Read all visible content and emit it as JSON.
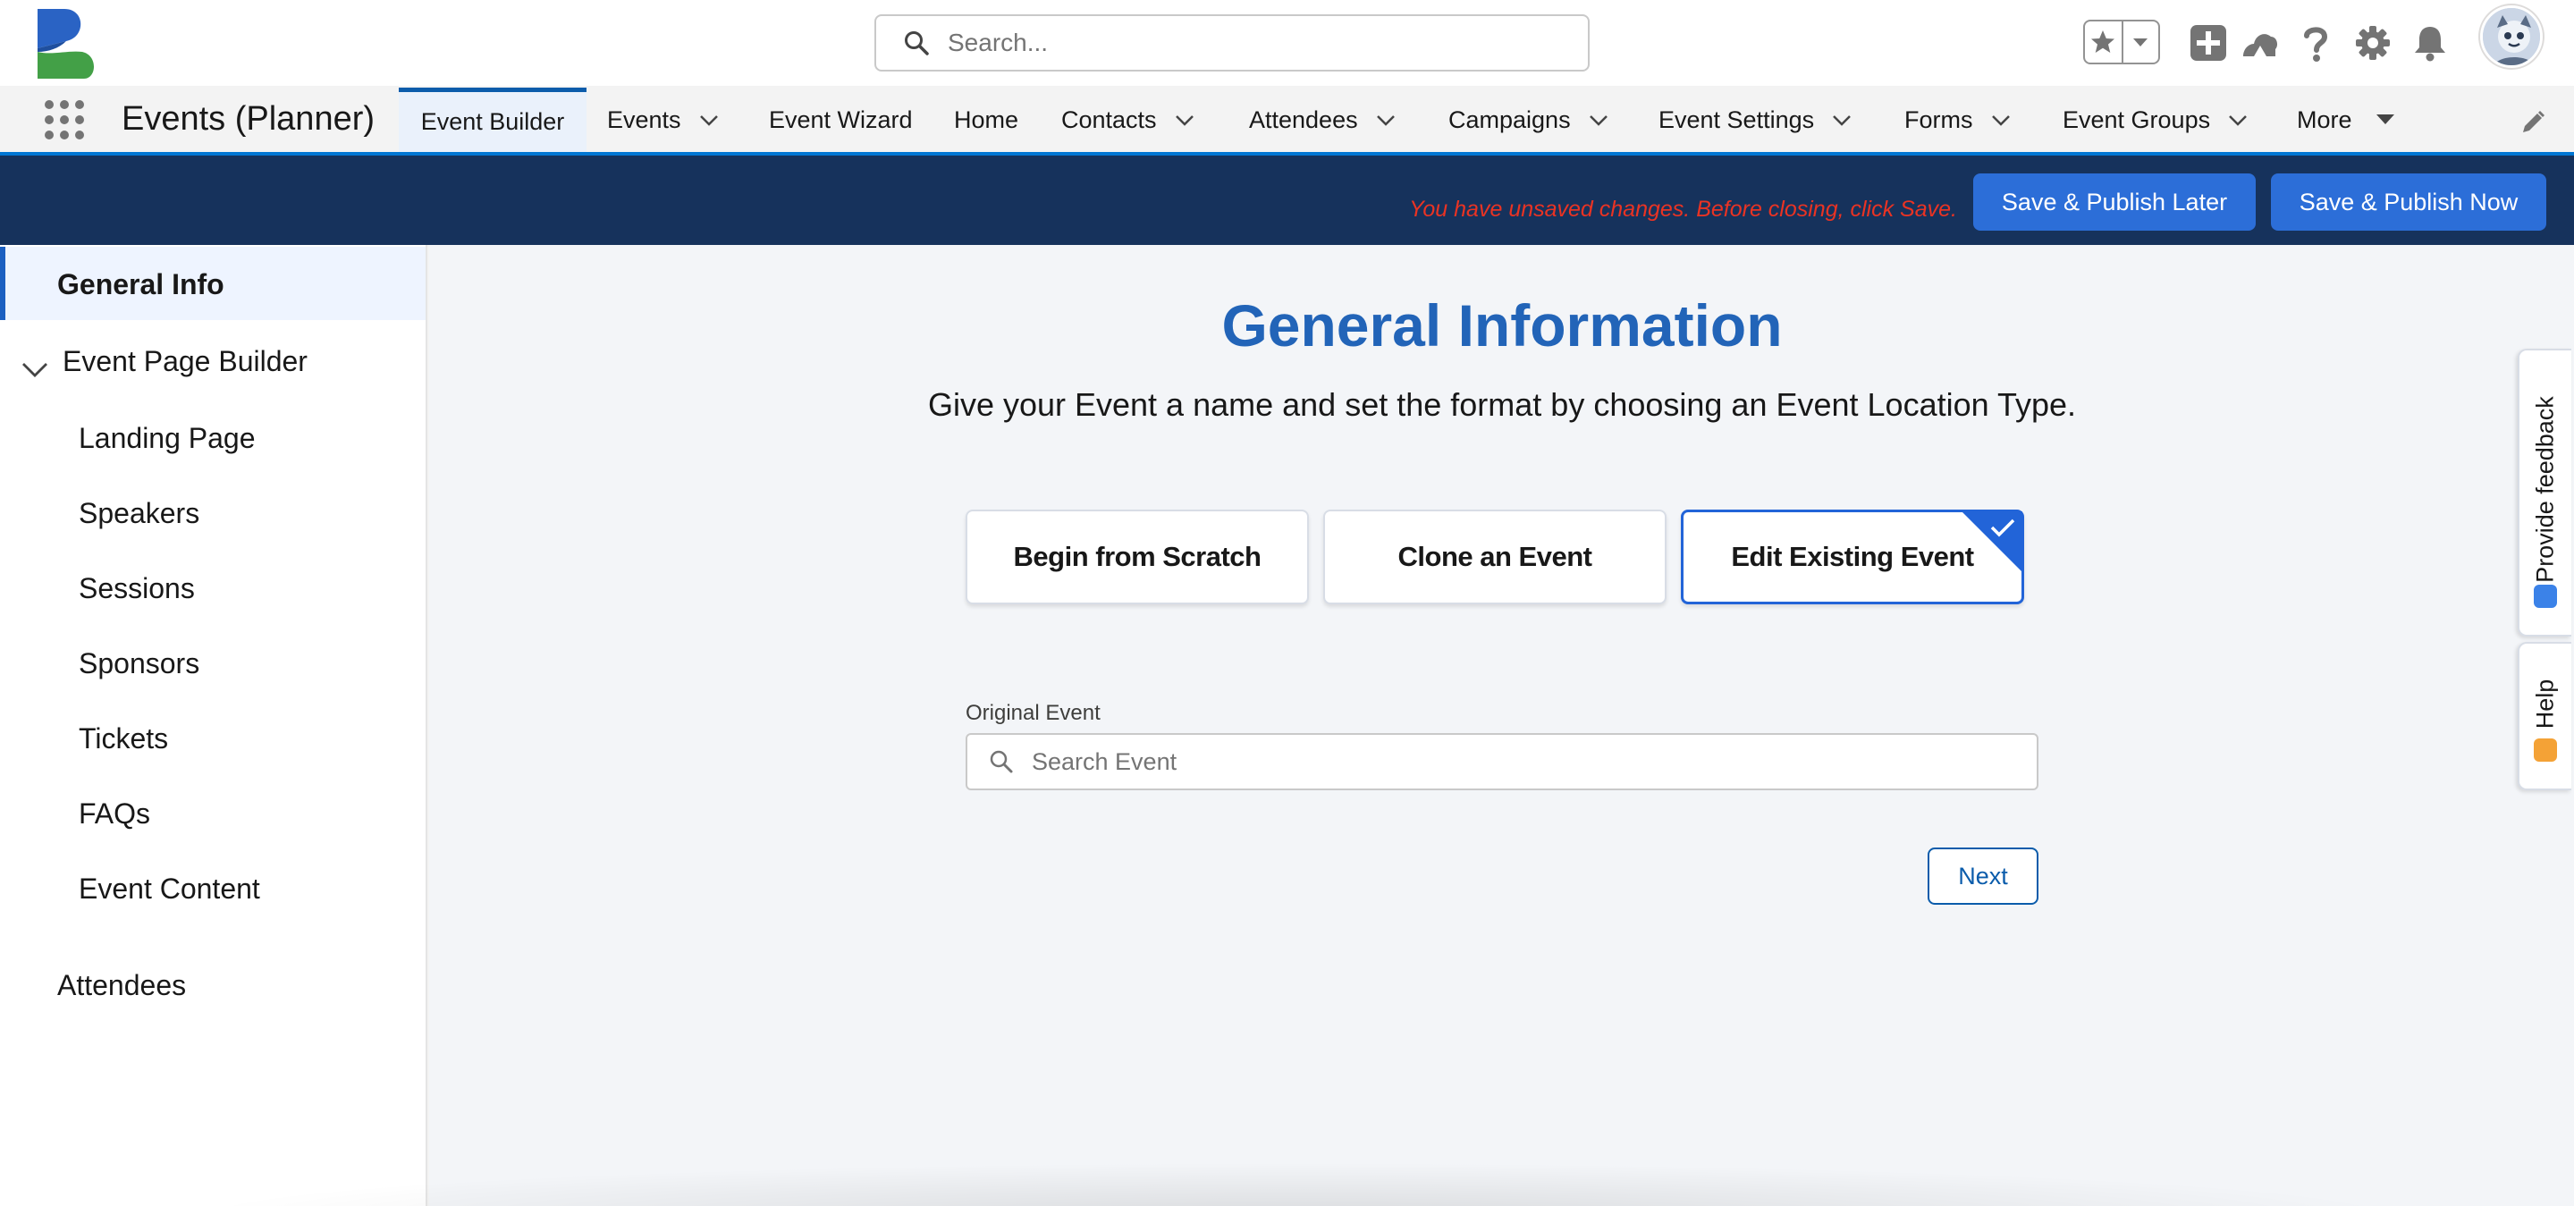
{
  "header": {
    "search_placeholder": "Search...",
    "icons": [
      "favorites-star-icon",
      "favorites-dropdown-icon",
      "add-icon",
      "trailhead-icon",
      "help-icon",
      "setup-gear-icon",
      "notification-bell-icon",
      "user-avatar"
    ]
  },
  "nav": {
    "app_name": "Events (Planner)",
    "tabs": [
      {
        "label": "Event Builder",
        "active": true,
        "dropdown": false
      },
      {
        "label": "Events",
        "dropdown": true
      },
      {
        "label": "Event Wizard",
        "dropdown": false
      },
      {
        "label": "Home",
        "dropdown": false
      },
      {
        "label": "Contacts",
        "dropdown": true
      },
      {
        "label": "Attendees",
        "dropdown": true
      },
      {
        "label": "Campaigns",
        "dropdown": true
      },
      {
        "label": "Event Settings",
        "dropdown": true
      },
      {
        "label": "Forms",
        "dropdown": true
      },
      {
        "label": "Event Groups",
        "dropdown": true
      },
      {
        "label": "More",
        "dropdown": true
      }
    ]
  },
  "action_bar": {
    "unsaved_message": "You have unsaved changes. Before closing, click Save.",
    "save_later_label": "Save & Publish Later",
    "save_now_label": "Save & Publish Now"
  },
  "sidebar": {
    "active_item": "General Info",
    "section": "Event Page Builder",
    "sub_items": [
      "Landing Page",
      "Speakers",
      "Sessions",
      "Sponsors",
      "Tickets",
      "FAQs",
      "Event Content"
    ],
    "bottom_item": "Attendees"
  },
  "main": {
    "title": "General Information",
    "subtitle": "Give your Event a name and set the format by choosing an Event Location Type.",
    "choices": [
      {
        "label": "Begin from Scratch",
        "selected": false
      },
      {
        "label": "Clone an Event",
        "selected": false
      },
      {
        "label": "Edit Existing Event",
        "selected": true
      }
    ],
    "original_event_label": "Original Event",
    "original_event_placeholder": "Search Event",
    "next_label": "Next"
  },
  "dock": {
    "feedback_label": "Provide feedback",
    "help_label": "Help"
  },
  "colors": {
    "accent": "#2264b8",
    "action_bar": "#16325c",
    "primary_button": "#2c6ed8",
    "warning_text": "#ea3323"
  }
}
